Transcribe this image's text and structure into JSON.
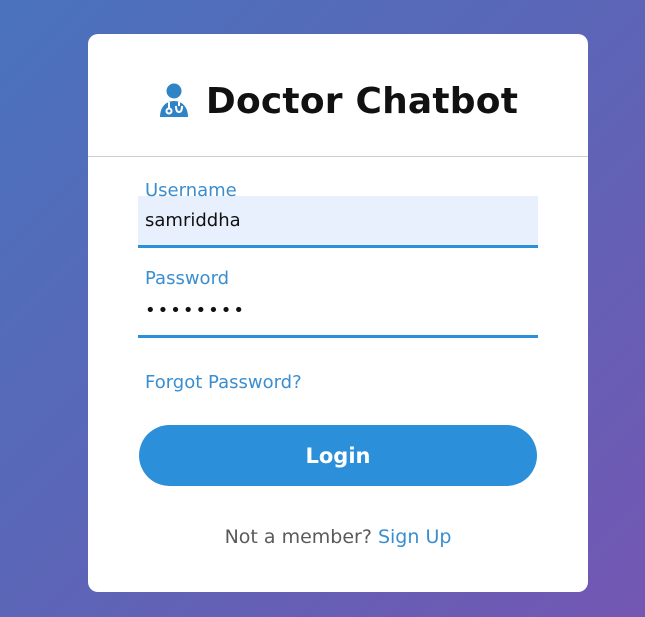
{
  "header": {
    "title": "Doctor Chatbot",
    "icon": "doctor-icon"
  },
  "form": {
    "username": {
      "label": "Username",
      "value": "samriddha"
    },
    "password": {
      "label": "Password",
      "value": "••••••••"
    },
    "forgot_password_label": "Forgot Password?",
    "login_label": "Login"
  },
  "footer": {
    "prompt": "Not a member?",
    "signup_label": "Sign Up"
  },
  "colors": {
    "accent": "#2b90d9",
    "label": "#3a8ed0",
    "autofill_bg": "#e8f0fe",
    "background_start": "#4a73bd",
    "background_end": "#7357b3"
  }
}
